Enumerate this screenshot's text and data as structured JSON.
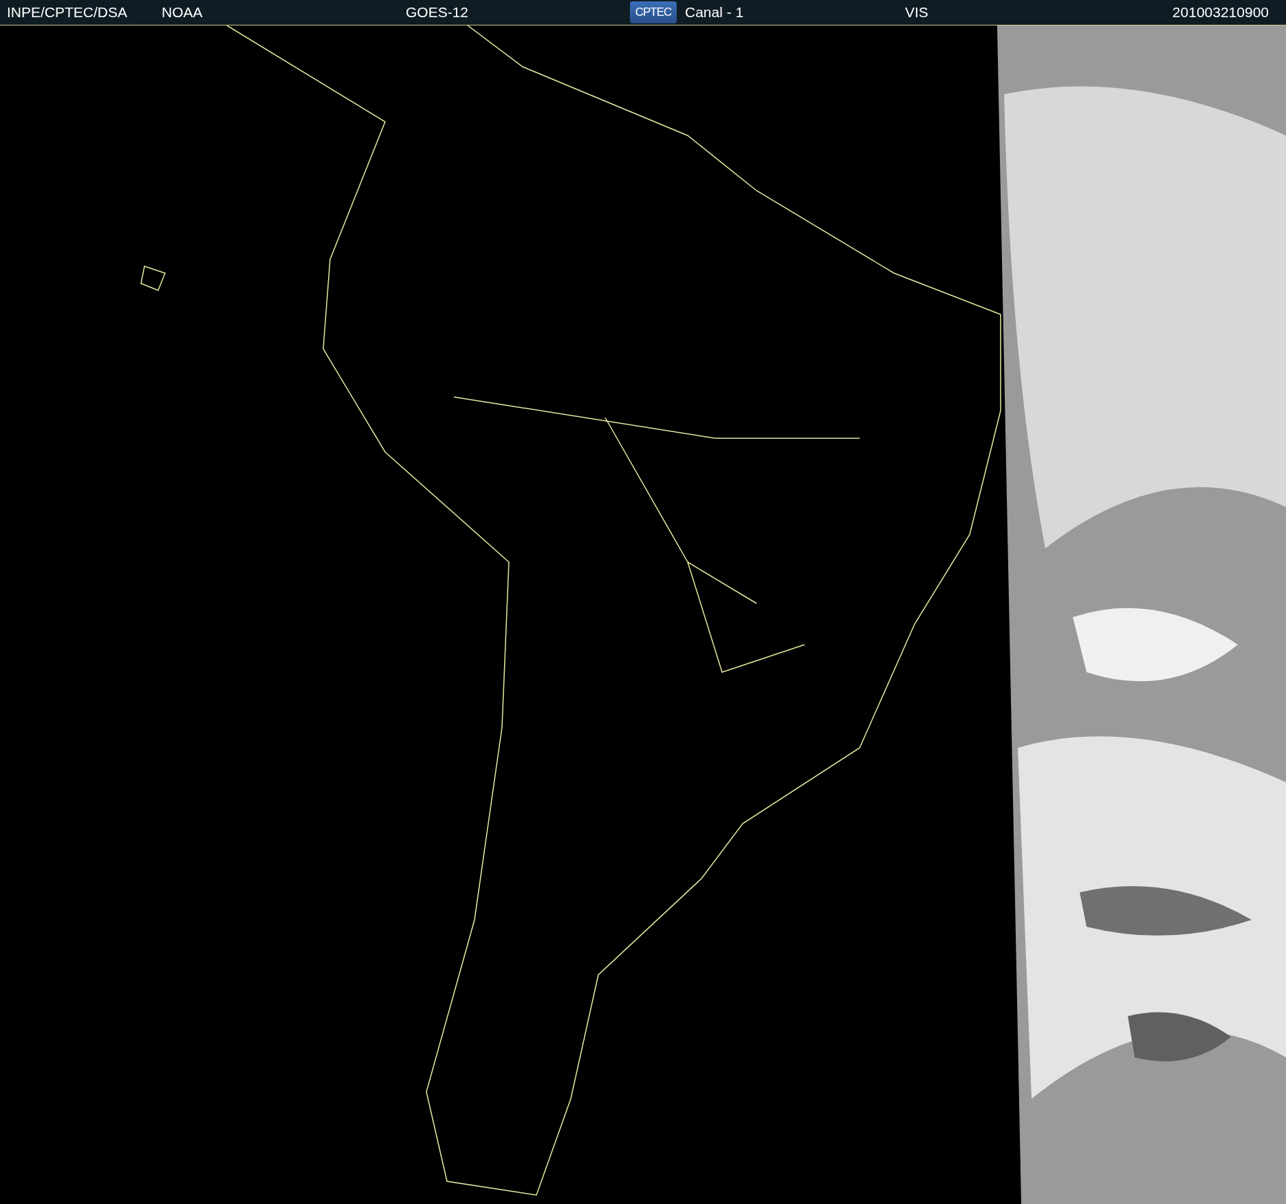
{
  "header": {
    "source": "INPE/CPTEC/DSA",
    "agency": "NOAA",
    "satellite": "GOES-12",
    "logo": "CPTEC",
    "channel": "Canal - 1",
    "band": "VIS",
    "timestamp": "201003210900"
  }
}
